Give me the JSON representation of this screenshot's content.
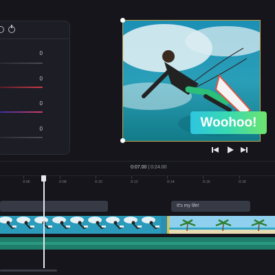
{
  "adjust_panel": {
    "values": [
      "0",
      "0",
      "0",
      "0"
    ],
    "slider_colors": [
      "#3a3b44",
      "#d23b4a",
      "#8a3fb5",
      "#3a3b44"
    ],
    "icons": [
      "circle-icon",
      "gauge-icon"
    ]
  },
  "preview": {
    "caption": "Woohoo!",
    "caption_colors": [
      "#2ec6e0",
      "#6ee46f"
    ],
    "selection_border_color": "#c6a54c"
  },
  "player": {
    "controls": [
      "skip-back-icon",
      "play-icon",
      "skip-forward-icon"
    ],
    "current_time": "0:07.00",
    "separator": "|",
    "total_time": "0:24.00"
  },
  "timeline": {
    "ticks": [
      "0:00",
      "0:06",
      "0:08",
      "0:10",
      "0:12",
      "0:14",
      "0:16",
      "0:18"
    ],
    "text_clip": "It's my life!",
    "audio_color": "#1f7e6b"
  }
}
